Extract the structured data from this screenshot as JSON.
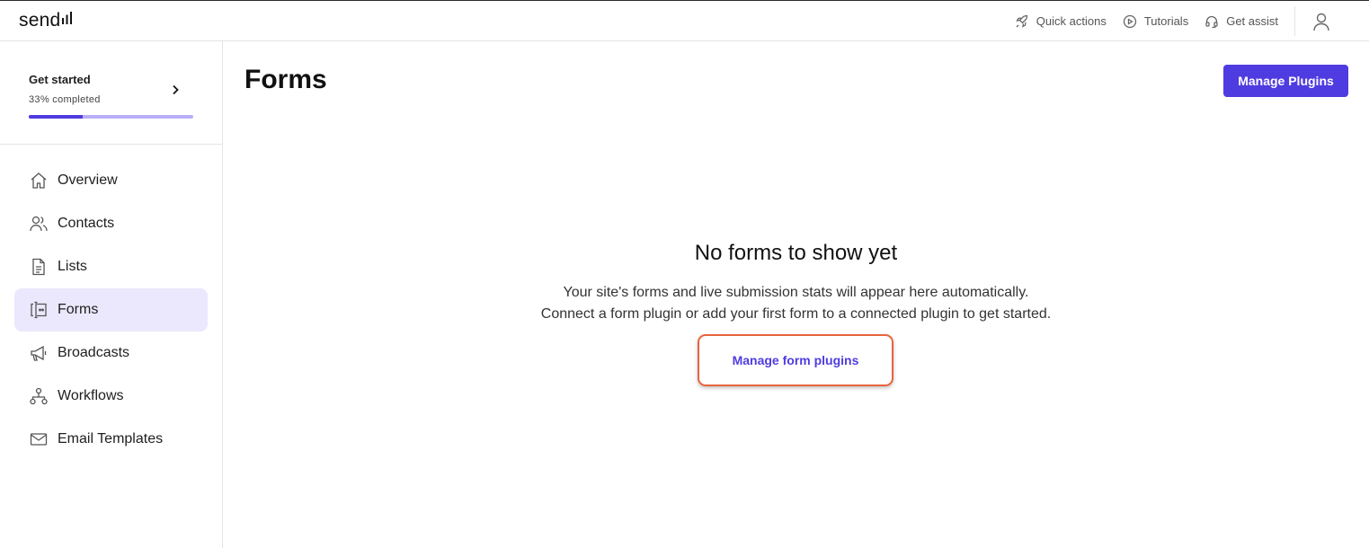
{
  "brand": {
    "name": "send"
  },
  "topbar": {
    "quick_actions": "Quick actions",
    "tutorials": "Tutorials",
    "get_assist": "Get assist"
  },
  "get_started": {
    "title": "Get started",
    "progress_text": "33% completed",
    "progress_percent": 33
  },
  "sidebar": {
    "items": [
      {
        "label": "Overview",
        "icon": "home-icon",
        "active": false
      },
      {
        "label": "Contacts",
        "icon": "contacts-icon",
        "active": false
      },
      {
        "label": "Lists",
        "icon": "list-icon",
        "active": false
      },
      {
        "label": "Forms",
        "icon": "form-icon",
        "active": true
      },
      {
        "label": "Broadcasts",
        "icon": "megaphone-icon",
        "active": false
      },
      {
        "label": "Workflows",
        "icon": "workflow-icon",
        "active": false
      },
      {
        "label": "Email Templates",
        "icon": "email-icon",
        "active": false
      }
    ]
  },
  "main": {
    "title": "Forms",
    "manage_plugins_label": "Manage Plugins",
    "empty_state": {
      "title": "No forms to show yet",
      "line1": "Your site's forms and live submission stats will appear here automatically.",
      "line2": "Connect a form plugin or add your first form to a connected plugin to get started.",
      "link_label": "Manage form plugins"
    }
  },
  "colors": {
    "accent": "#4f3ce0",
    "active_nav_bg": "#ebe8fd",
    "highlight_outline": "#e8643c"
  }
}
